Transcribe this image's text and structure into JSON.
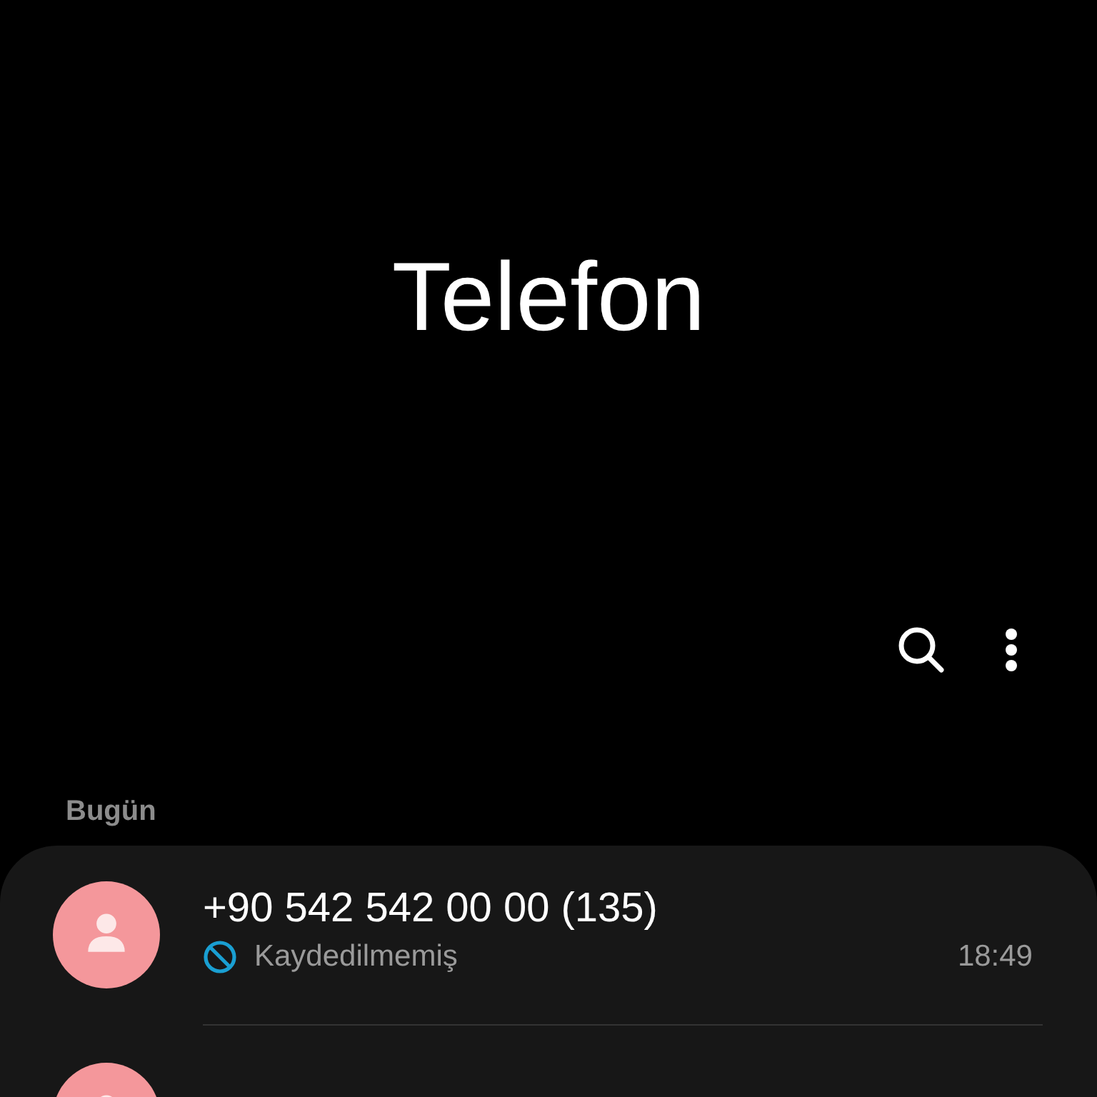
{
  "header": {
    "title": "Telefon"
  },
  "section": {
    "label": "Bugün"
  },
  "calls": [
    {
      "kind": "contact",
      "number": "+90 542 542 00 00 (135)",
      "blocked": true,
      "status": "Kaydedilmemiş",
      "time": "18:49"
    },
    {
      "kind": "contact"
    }
  ]
}
